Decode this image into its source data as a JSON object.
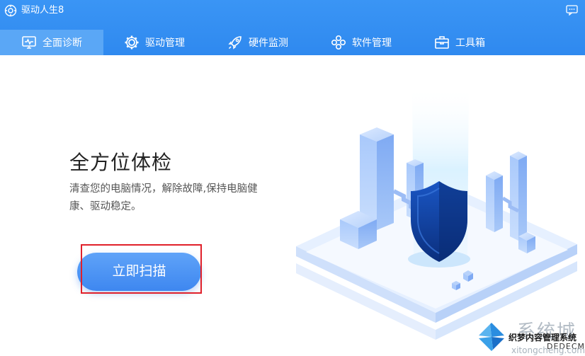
{
  "app": {
    "title": "驱动人生8"
  },
  "nav": {
    "tabs": [
      {
        "label": "全面诊断",
        "icon": "monitor-pulse-icon",
        "active": true
      },
      {
        "label": "驱动管理",
        "icon": "gear-icon",
        "active": false
      },
      {
        "label": "硬件监测",
        "icon": "rocket-icon",
        "active": false
      },
      {
        "label": "软件管理",
        "icon": "apps-grid-icon",
        "active": false
      },
      {
        "label": "工具箱",
        "icon": "toolbox-icon",
        "active": false
      }
    ]
  },
  "main": {
    "headline": "全方位体检",
    "description": "清查您的电脑情况，解除故障,保持电脑健康、驱动稳定。",
    "scan_button": "立即扫描"
  },
  "watermark": {
    "brand": "系统城",
    "mid_text": "织梦内容管理系统",
    "sub_text": "DEDECMS.COM",
    "url": "xitongcheng.com"
  },
  "colors": {
    "topbar": "#2f89ef",
    "active_tab": "#5aa7f6",
    "button": "#3e87f0",
    "highlight": "#e0202a",
    "shield": "#0d3f9a"
  }
}
